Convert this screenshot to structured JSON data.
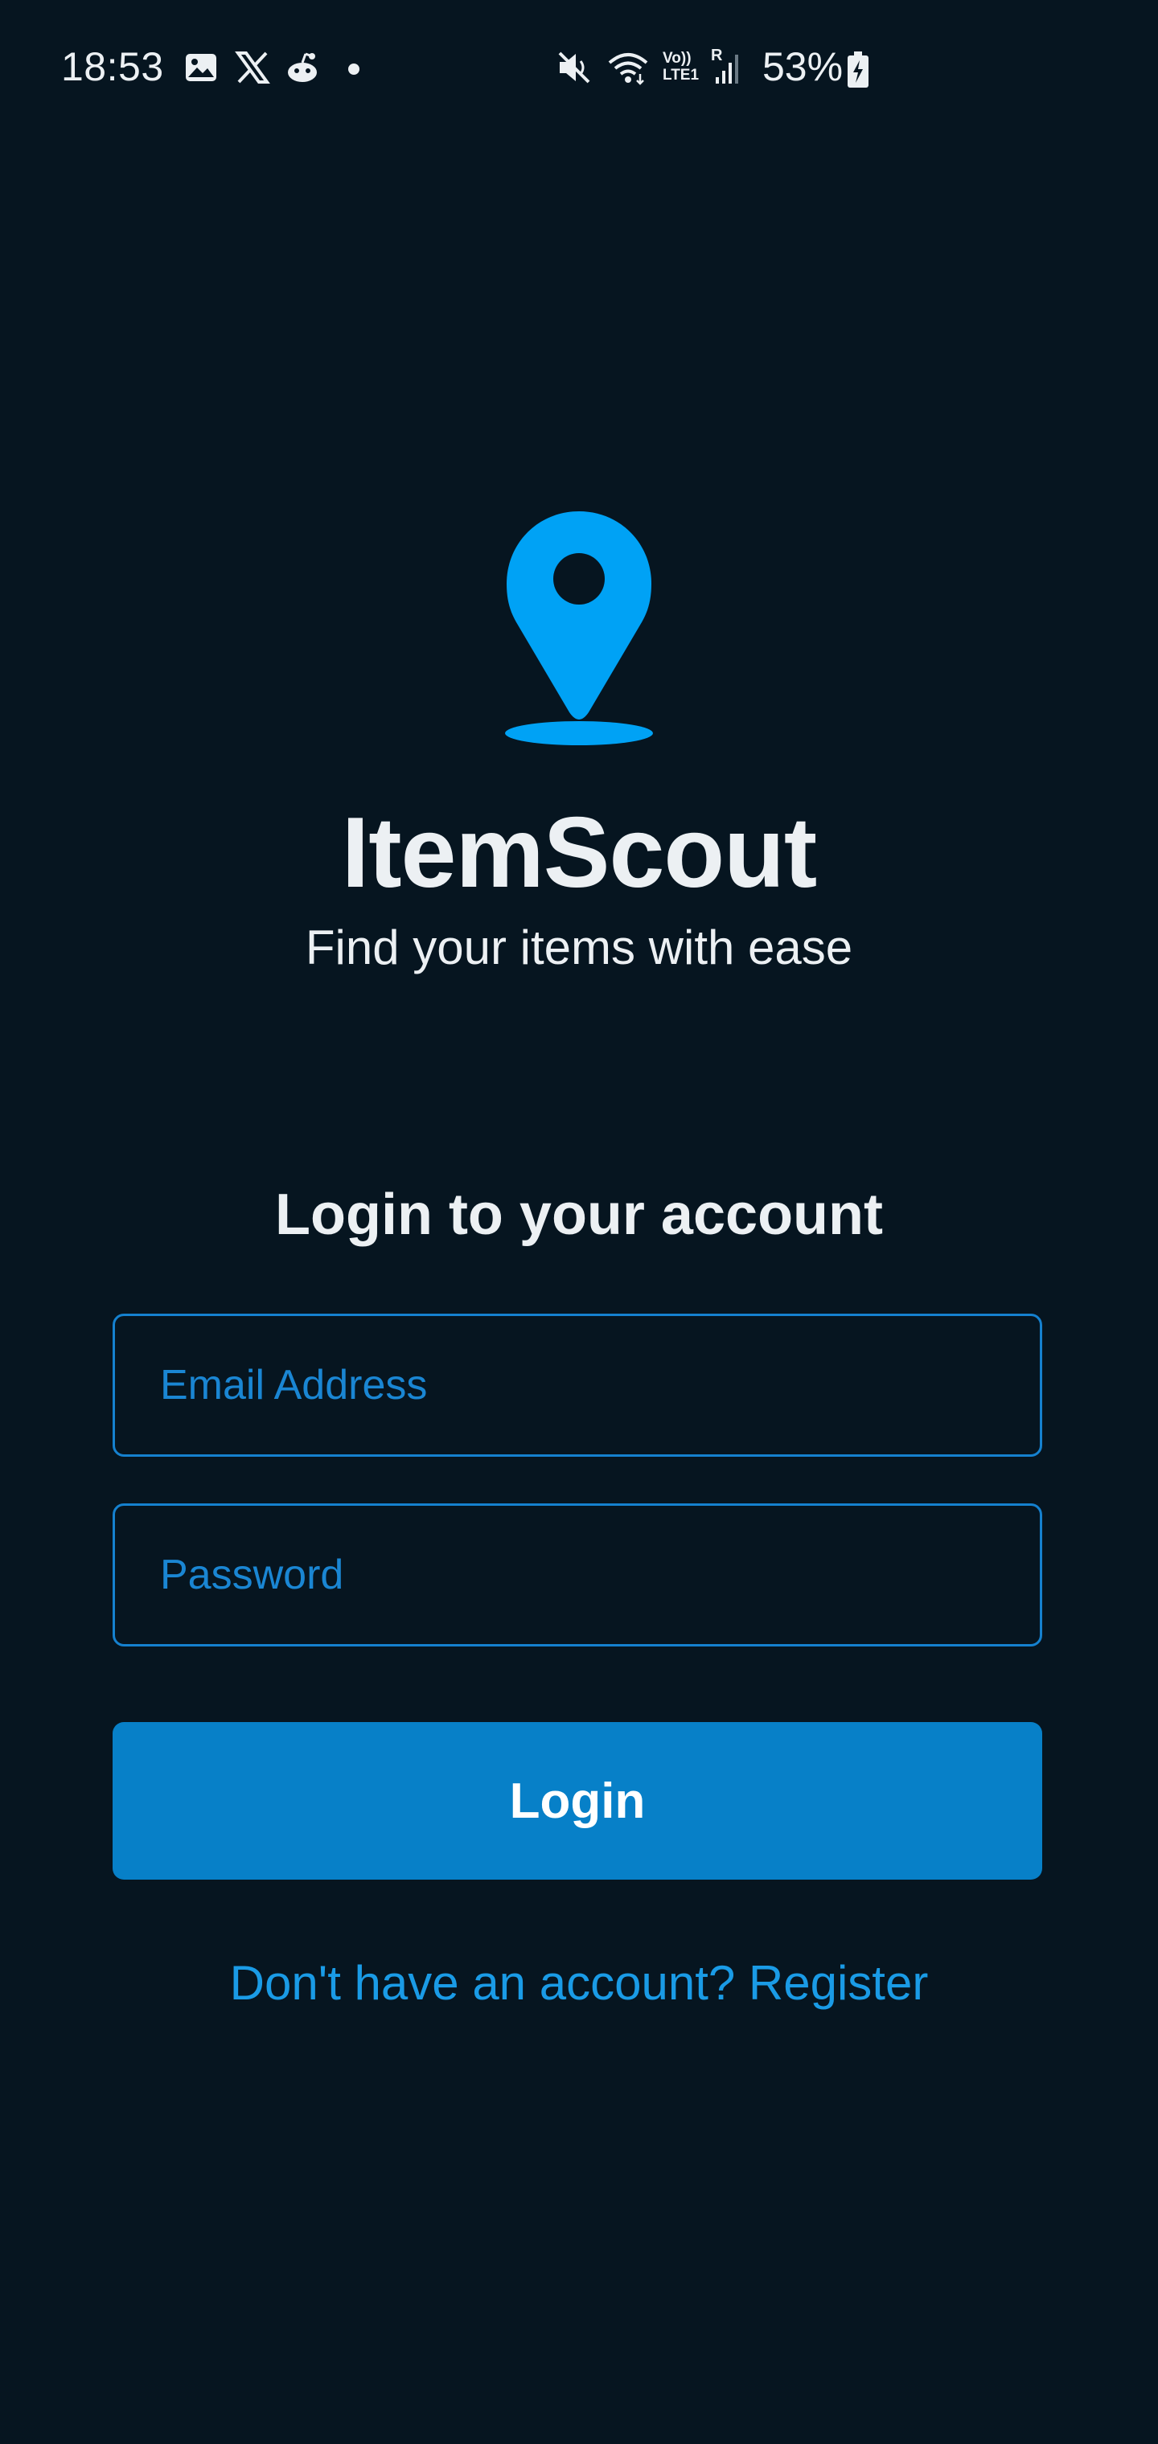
{
  "status_bar": {
    "time": "18:53",
    "battery": "53%",
    "left_icons": [
      "image-icon",
      "x-icon",
      "reddit-icon",
      "dot-icon"
    ],
    "right_icons": [
      "mute-icon",
      "wifi-icon",
      "volte-icon",
      "signal-icon",
      "battery-charging-icon"
    ],
    "volte_label": "Vo)) LTE1",
    "roaming_label": "R"
  },
  "branding": {
    "logo_icon": "location-pin-icon",
    "app_name": "ItemScout",
    "tagline": "Find your items with ease",
    "accent_color": "#00a2f5"
  },
  "login": {
    "heading": "Login to your account",
    "email_placeholder": "Email Address",
    "email_value": "",
    "password_placeholder": "Password",
    "password_value": "",
    "button_label": "Login",
    "register_link": "Don't have an account? Register",
    "button_color": "#0780c8",
    "field_border_color": "#1581cf"
  }
}
